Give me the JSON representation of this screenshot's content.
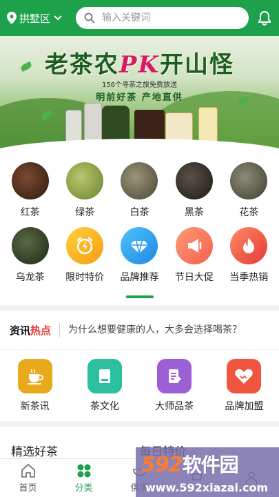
{
  "header": {
    "location": "拱墅区",
    "search_placeholder": "输入关键词"
  },
  "banner": {
    "headline_left": "老茶农",
    "headline_pk": "PK",
    "headline_right": "开山怪",
    "subtitle": "156个寻茶之旅免费放送",
    "tagline": "明前好茶  产地直供"
  },
  "categories": {
    "row1": [
      {
        "label": "红茶",
        "color": "#5a3a2a"
      },
      {
        "label": "绿茶",
        "color": "#8fa84a"
      },
      {
        "label": "白茶",
        "color": "#6e6a52"
      },
      {
        "label": "黑茶",
        "color": "#3a3530"
      },
      {
        "label": "花茶",
        "color": "#6a6a5a"
      }
    ],
    "row2": [
      {
        "label": "乌龙茶",
        "icon": "oolong-tea-image"
      },
      {
        "label": "限时特价",
        "icon": "alarm-clock-icon"
      },
      {
        "label": "品牌推荐",
        "icon": "diamond-icon"
      },
      {
        "label": "节日大促",
        "icon": "megaphone-icon"
      },
      {
        "label": "当季热销",
        "icon": "flame-icon"
      }
    ]
  },
  "news": {
    "logo_left": "资讯",
    "logo_right": "热点",
    "headline": "为什么想要健康的人，大多会选择喝茶？"
  },
  "shortcuts": [
    {
      "label": "新茶讯",
      "icon": "teacup-icon",
      "color": "#e8a91c"
    },
    {
      "label": "茶文化",
      "icon": "book-icon",
      "color": "#2bbf9e"
    },
    {
      "label": "大师品茶",
      "icon": "document-icon",
      "color": "#9c5fd6"
    },
    {
      "label": "品牌加盟",
      "icon": "handshake-icon",
      "color": "#f0553f"
    }
  ],
  "featured": {
    "left_title": "精选好茶",
    "right_title": "每日特价"
  },
  "bottom_nav": [
    {
      "label": "首页",
      "icon": "home-icon"
    },
    {
      "label": "分类",
      "icon": "grid-icon",
      "active": true
    },
    {
      "label": "供求",
      "icon": "bowl-icon"
    },
    {
      "label": "",
      "icon": "cart-icon"
    },
    {
      "label": "",
      "icon": "user-icon"
    }
  ],
  "watermark": {
    "brand_number": "592",
    "brand_text": "软件园",
    "url": "www.592xiazai.com"
  },
  "colors": {
    "primary": "#1ea14b",
    "hot": "#e53935"
  }
}
